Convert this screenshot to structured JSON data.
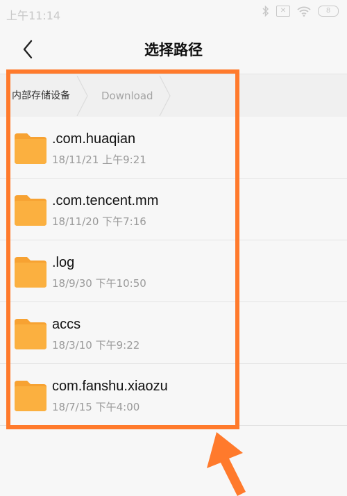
{
  "status": {
    "time": "上午11:14",
    "sim_text": "✕",
    "battery_level": "8"
  },
  "header": {
    "title": "选择路径"
  },
  "breadcrumb": {
    "root": "内部存储设备",
    "current": "Download"
  },
  "files": [
    {
      "name": ".com.huaqian",
      "date": "18/11/21 上午9:21"
    },
    {
      "name": ".com.tencent.mm",
      "date": "18/11/20 下午7:16"
    },
    {
      "name": ".log",
      "date": "18/9/30 下午10:50"
    },
    {
      "name": "accs",
      "date": "18/3/10 下午9:22"
    },
    {
      "name": "com.fanshu.xiaozu",
      "date": "18/7/15 下午4:00"
    }
  ],
  "colors": {
    "highlight": "#ff7a2c",
    "folder": "#fbb040",
    "folder_tab": "#f7a232"
  },
  "icons": {
    "back": "chevron-left-icon",
    "folder": "folder-icon",
    "bluetooth": "bluetooth-icon",
    "wifi": "wifi-icon",
    "battery": "battery-icon"
  }
}
